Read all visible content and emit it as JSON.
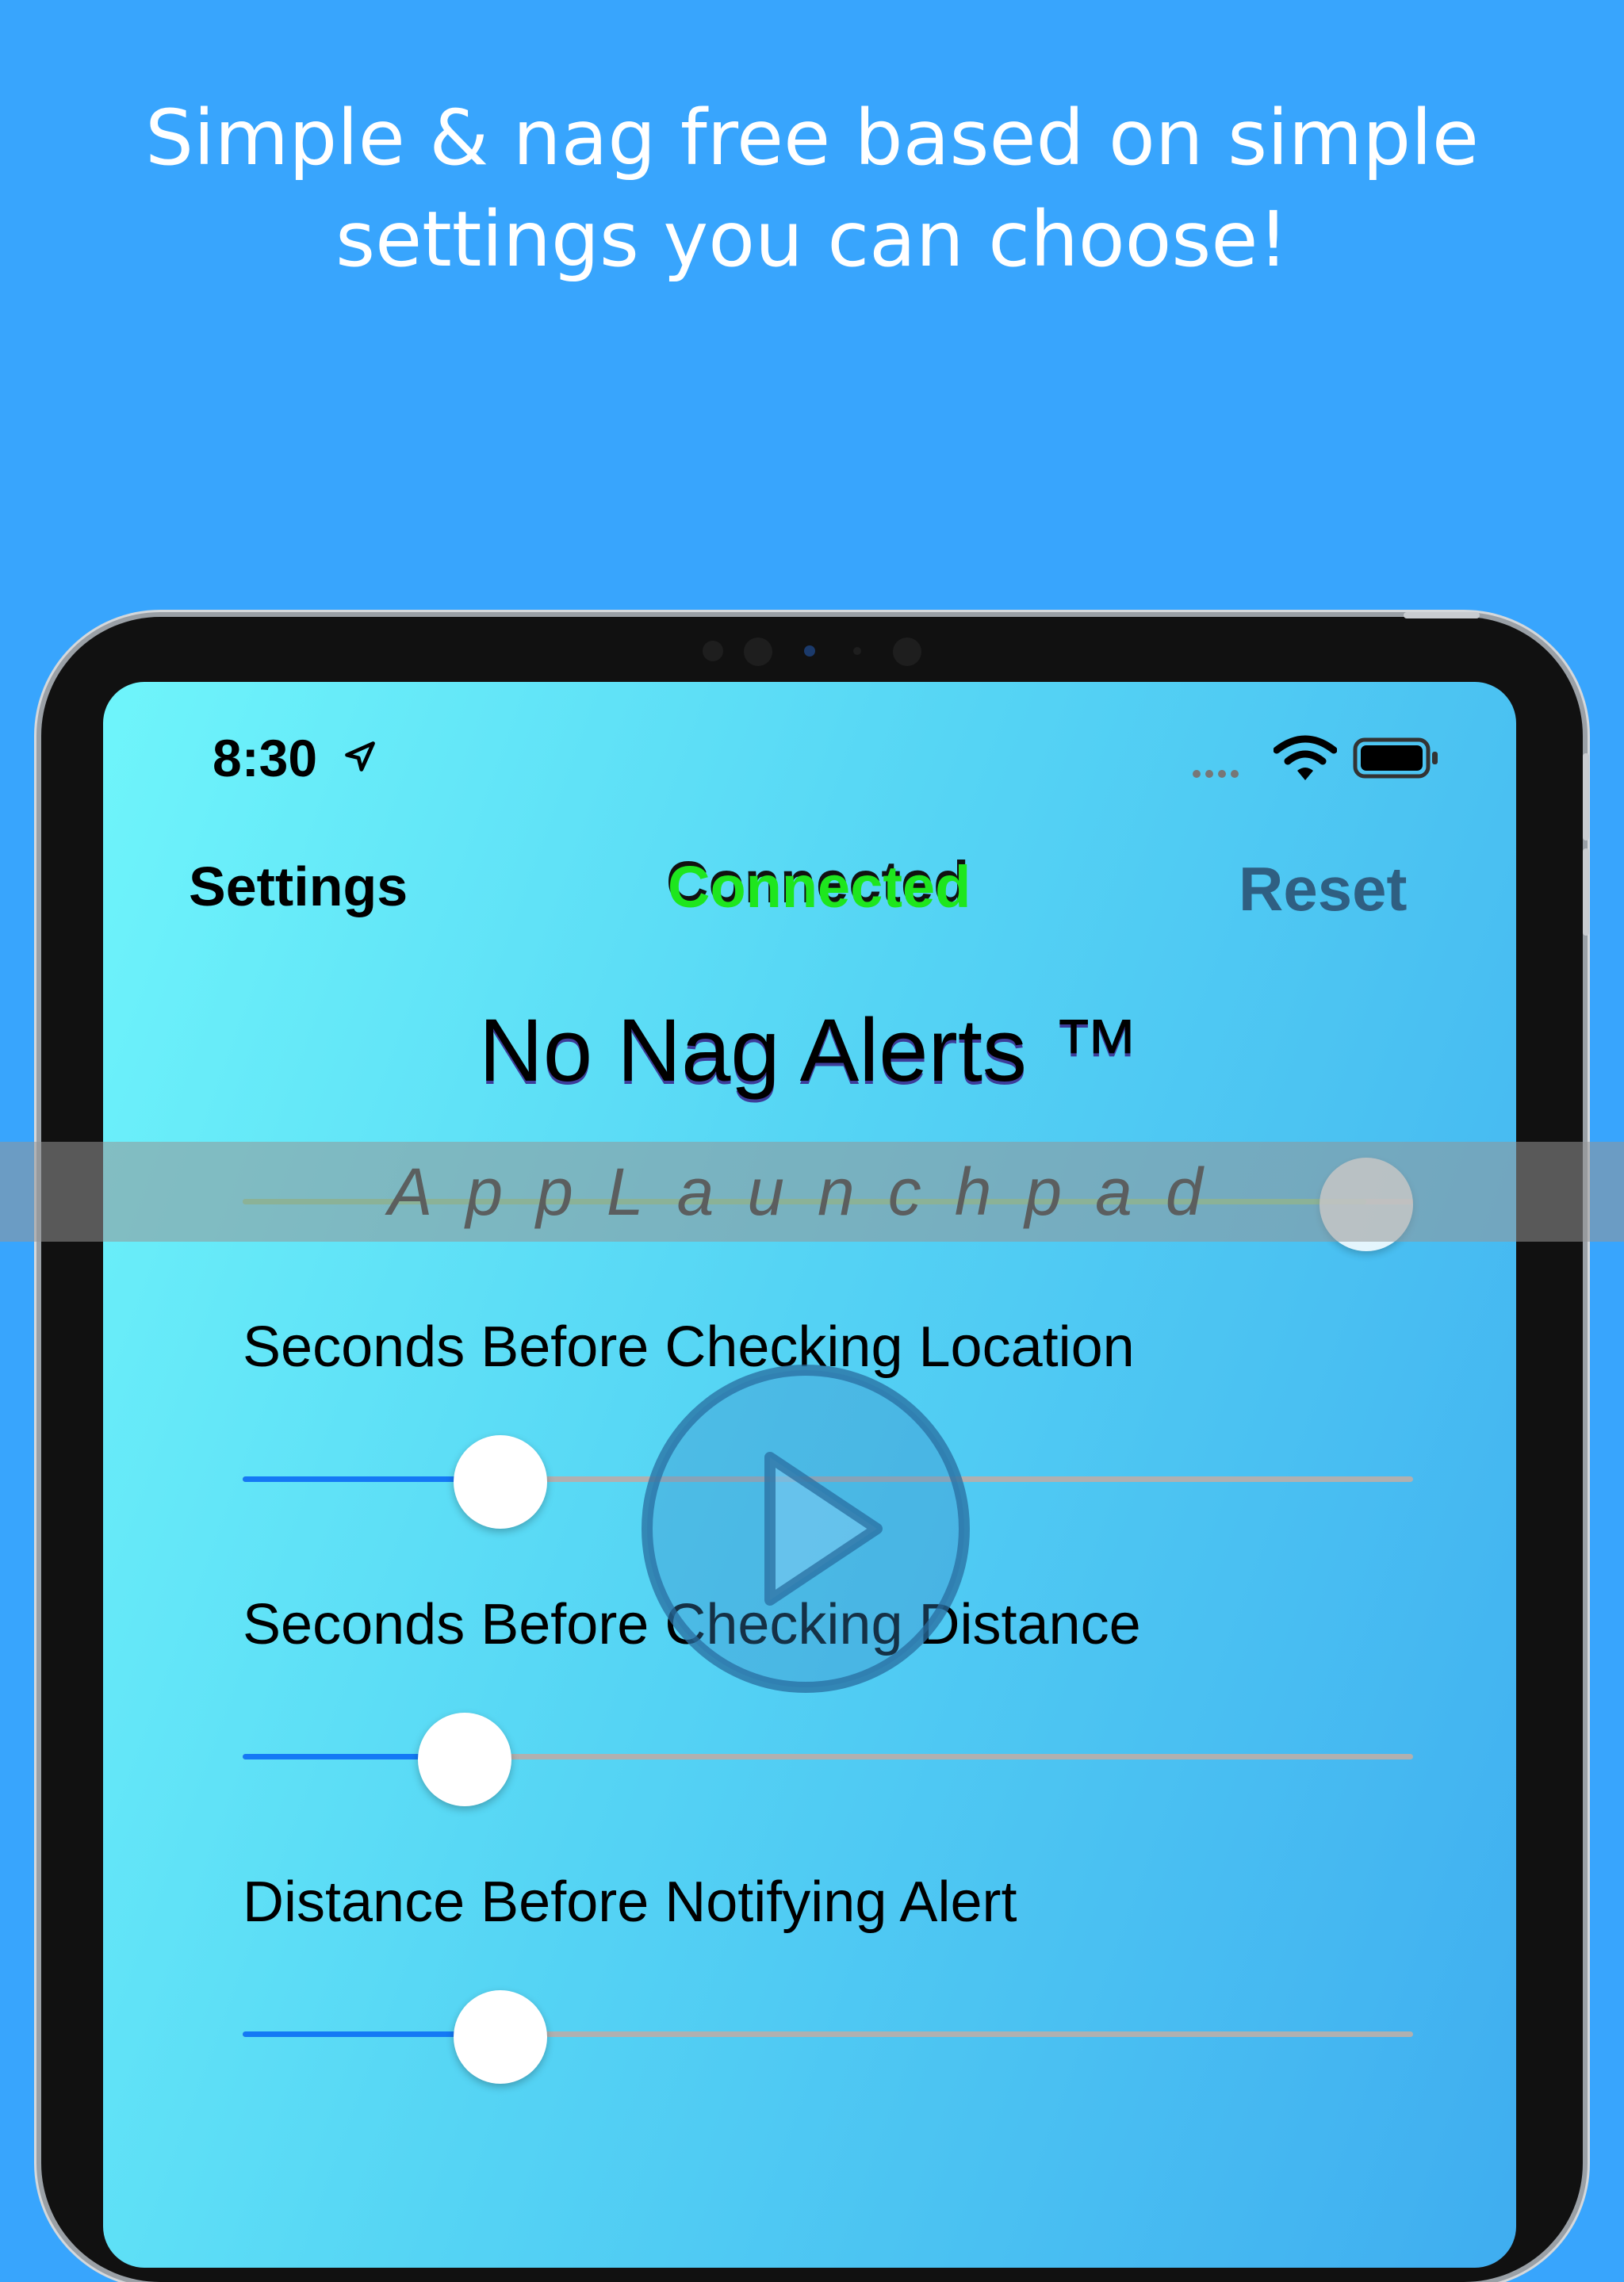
{
  "headline": {
    "line1": "Simple & nag free based on simple",
    "line2": "settings you can choose!"
  },
  "status_bar": {
    "time": "8:30",
    "icons": [
      "location-arrow-icon",
      "cellular-signal-icon",
      "wifi-icon",
      "battery-icon"
    ]
  },
  "nav": {
    "left": "Settings",
    "center": "Connected",
    "right": "Reset"
  },
  "app_title": "No Nag Alerts  ™",
  "watermark": "AppLaunchpad",
  "sliders": [
    {
      "label": "",
      "value_fraction": 0.96
    },
    {
      "label": "Seconds Before Checking Location",
      "value_fraction": 0.22
    },
    {
      "label": "Seconds Before Checking Distance",
      "value_fraction": 0.19
    },
    {
      "label": "Distance Before Notifying Alert",
      "value_fraction": 0.22
    }
  ],
  "colors": {
    "page_background": "#38a5fd",
    "screen_gradient_start": "#6ff5fb",
    "screen_gradient_end": "#3fadf0",
    "connected_text": "#1ee61e",
    "reset_text": "#2f5f82",
    "slider_active": "#1479f5",
    "slider_inactive": "#b0b0b0"
  }
}
